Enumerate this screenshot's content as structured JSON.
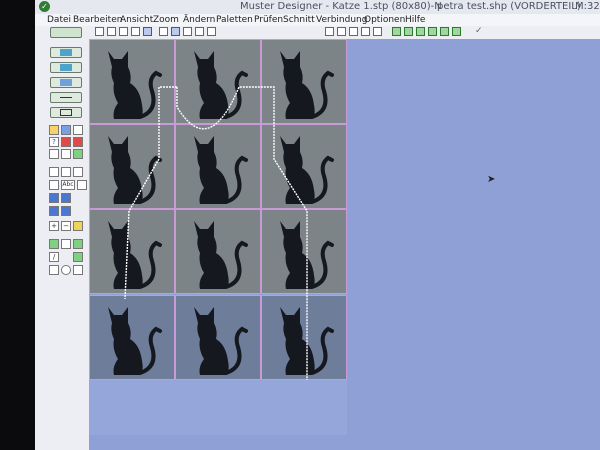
{
  "window": {
    "app_title": "Muster Designer - Katze 1.stp (80x80)-N",
    "shape_file": "petra test.shp (VORDERTEIL)",
    "status": "M:32"
  },
  "menu": [
    "Datei",
    "Bearbeiten",
    "Ansicht",
    "Zoom",
    "Ändern",
    "Paletten",
    "Prüfen",
    "Schnitt",
    "Verbindung",
    "Optionen",
    "Hilfe"
  ],
  "colors": {
    "canvas": "#8ea0d6",
    "tile_grid": "#c99bd6",
    "cat": "#15181e",
    "shape_outline": "#ffffff"
  },
  "left_panel": {
    "small_tools": [
      "Abc"
    ]
  }
}
